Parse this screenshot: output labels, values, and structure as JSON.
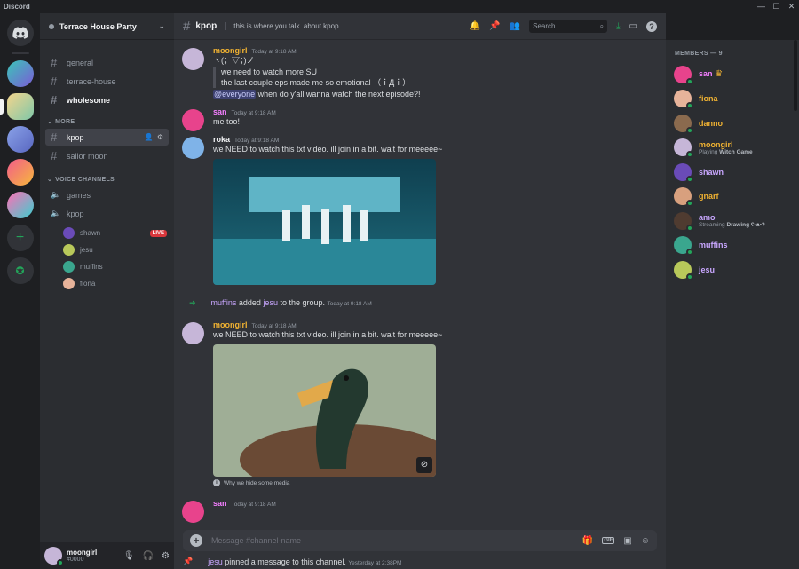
{
  "window": {
    "title": "Discord",
    "controls": [
      "—",
      "☐",
      "✕"
    ]
  },
  "colors": {
    "accent": "#5865f2",
    "online": "#23a55a",
    "live": "#da373c",
    "bg_main": "#313338",
    "bg_side": "#2b2d31"
  },
  "guild": {
    "name": "Terrace House Party"
  },
  "channels": {
    "text": [
      {
        "name": "general"
      },
      {
        "name": "terrace-house"
      },
      {
        "name": "wholesome"
      }
    ],
    "more_label": "MORE",
    "more": [
      {
        "name": "kpop"
      },
      {
        "name": "sailor moon"
      }
    ],
    "voice_label": "VOICE CHANNELS",
    "voice": [
      {
        "name": "games"
      },
      {
        "name": "kpop"
      }
    ],
    "voice_users": [
      {
        "name": "shawn",
        "badge": "LIVE"
      },
      {
        "name": "jesu"
      },
      {
        "name": "muffins"
      },
      {
        "name": "fiona"
      }
    ]
  },
  "user_panel": {
    "name": "moongirl",
    "tag": "#0000"
  },
  "header": {
    "channel": "kpop",
    "topic": "this is where you talk. about kpop.",
    "search_placeholder": "Search"
  },
  "messages": [
    {
      "author": "moongirl",
      "author_color": "#f0b232",
      "time": "Today at 9:18 AM",
      "first": "ヽ(；▽；)ノ",
      "quote": [
        "we need to watch more SU",
        "the last couple eps made me so emotional （ｉДｉ）"
      ],
      "mention": "@everyone",
      "after_mention": " when do y'all wanna watch the next episode?!"
    },
    {
      "author": "san",
      "author_color": "#f47fff",
      "time": "Today at 9:18 AM",
      "text": "me too!"
    },
    {
      "author": "roka",
      "author_color": "#f2f3f5",
      "time": "Today at 9:18 AM",
      "text": "we NEED to watch this txt video. ill join in a bit. wait for meeeee~"
    },
    {
      "author": "moongirl",
      "author_color": "#f0b232",
      "time": "Today at 9:18 AM",
      "text": "we NEED to watch this txt video. ill join in a bit. wait for meeeee~"
    },
    {
      "author": "san",
      "author_color": "#f47fff",
      "time": "Today at 9:18 AM"
    }
  ],
  "system": {
    "added": {
      "actor": "muffins",
      "verb": " added ",
      "target": "jesu",
      "rest": " to the group.",
      "time": "Today at 9:18 AM"
    },
    "pinned": {
      "actor": "jesu",
      "rest": " pinned a message to this channel.",
      "time": "Yesterday at 2:38PM"
    }
  },
  "media_notice": "Why we hide some media",
  "composer": {
    "placeholder": "Message #channel-name",
    "gif_label": "GIF"
  },
  "members": {
    "title": "MEMBERS — 9",
    "list": [
      {
        "name": "san",
        "color": "#f47fff",
        "avatar": "#e8438c",
        "crown": true
      },
      {
        "name": "fiona",
        "color": "#f0b232",
        "avatar": "#e7b39a"
      },
      {
        "name": "danno",
        "color": "#f0b232",
        "avatar": "#8a6a4e"
      },
      {
        "name": "moongirl",
        "color": "#f0b232",
        "avatar": "#c6b6d8",
        "activity_prefix": "Playing ",
        "activity_bold": "Witch Game"
      },
      {
        "name": "shawn",
        "color": "#c9a7ff",
        "avatar": "#6a4bb8"
      },
      {
        "name": "gnarf",
        "color": "#f0b232",
        "avatar": "#d8a07e"
      },
      {
        "name": "amo",
        "color": "#c9a7ff",
        "avatar": "#4f3b30",
        "activity_prefix": "Streaming ",
        "activity_bold": "Drawing ʕ•ᴥ•ʔ"
      },
      {
        "name": "muffins",
        "color": "#c9a7ff",
        "avatar": "#3aa68e"
      },
      {
        "name": "jesu",
        "color": "#c9a7ff",
        "avatar": "#b8c85a"
      }
    ]
  }
}
